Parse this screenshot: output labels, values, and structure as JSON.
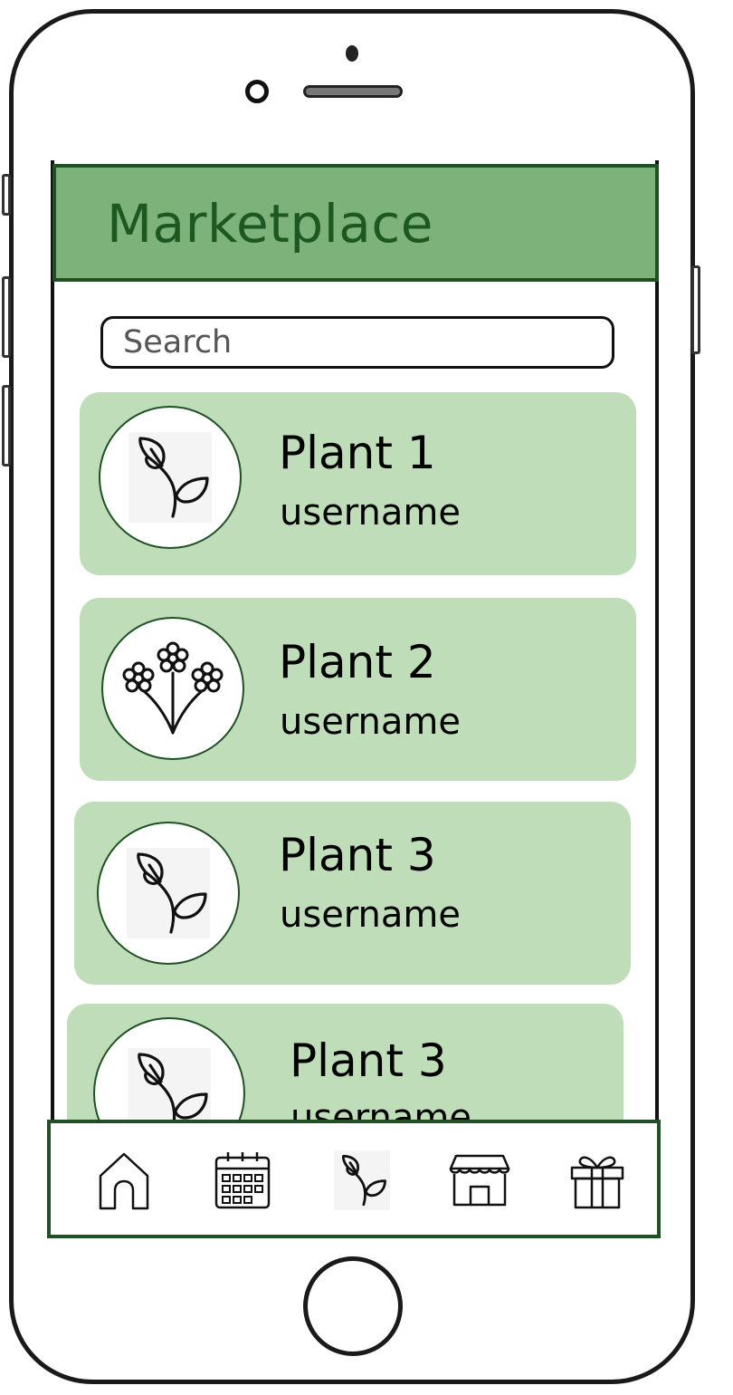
{
  "header": {
    "title": "Marketplace"
  },
  "search": {
    "placeholder": "Search"
  },
  "listings": [
    {
      "title": "Plant 1",
      "username": "username",
      "icon": "sprout-icon"
    },
    {
      "title": "Plant 2",
      "username": "username",
      "icon": "flowers-icon"
    },
    {
      "title": "Plant 3",
      "username": "username",
      "icon": "sprout-icon"
    },
    {
      "title": "Plant 3",
      "username": "username",
      "icon": "sprout-icon"
    }
  ],
  "nav": [
    {
      "icon": "home-icon"
    },
    {
      "icon": "calendar-icon"
    },
    {
      "icon": "sprout-icon"
    },
    {
      "icon": "store-icon"
    },
    {
      "icon": "gift-icon"
    }
  ],
  "colors": {
    "header_bg": "#7db37a",
    "header_text": "#1d5722",
    "card_bg": "#c0ddb9",
    "accent_border": "#1f5124"
  }
}
